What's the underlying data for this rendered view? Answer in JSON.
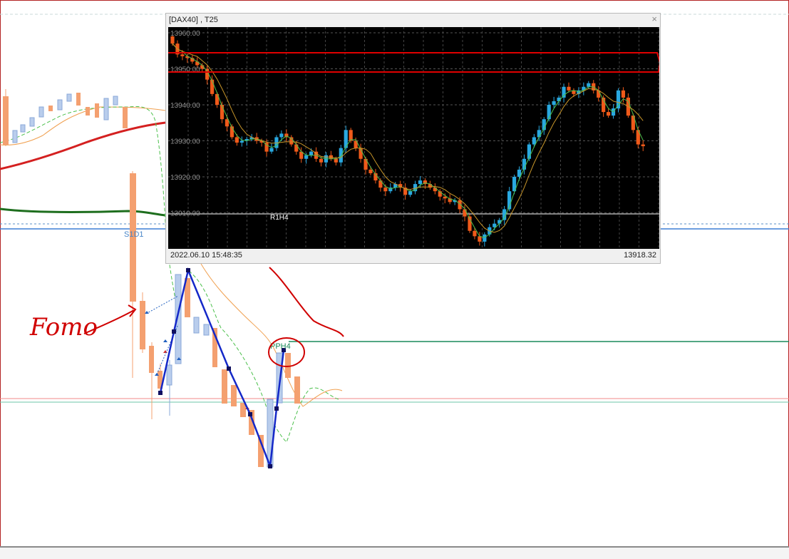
{
  "window": {
    "title": "[DAX40] , T25",
    "close_glyph": "×",
    "timestamp": "2022.06.10 15:48:35",
    "last_price": "13918.32"
  },
  "popup_chart": {
    "y_axis_labels": [
      "13960.00",
      "13950.00",
      "13940.00",
      "13930.00",
      "13920.00",
      "13910.00"
    ],
    "level_label": "R1H4"
  },
  "background_chart": {
    "level_labels": {
      "s1": "S1D1",
      "pp": "PPH4"
    },
    "annotation_text": "Fomo"
  },
  "colors": {
    "bull_popup": "#29a8e0",
    "bear_popup": "#f05a1a",
    "bull_bg": "#b9cdec",
    "bear_bg": "#f4a070",
    "annotation": "#d00000",
    "zigzag": "#1428c8"
  },
  "chart_data": {
    "type": "candlestick",
    "symbol": "DAX40",
    "timeframe": "T25",
    "ylim": [
      13902,
      13962
    ],
    "close": [
      13957,
      13954,
      13953.5,
      13953,
      13952,
      13951,
      13950,
      13947,
      13943,
      13940,
      13936,
      13934,
      13931,
      13929.5,
      13930,
      13930.5,
      13931,
      13930,
      13929.5,
      13927,
      13928,
      13931,
      13932,
      13931,
      13929,
      13927,
      13925,
      13926,
      13927,
      13925,
      13924,
      13926,
      13925,
      13924,
      13928,
      13933,
      13930,
      13928,
      13925,
      13922,
      13921,
      13919,
      13917,
      13916,
      13917,
      13918,
      13917,
      13915,
      13916,
      13918,
      13919,
      13918,
      13917,
      13916,
      13914.5,
      13914,
      13913,
      13913.5,
      13911,
      13909,
      13905,
      13903.5,
      13902,
      13904,
      13906,
      13907,
      13908,
      13911,
      13916,
      13920,
      13922,
      13925,
      13929,
      13931,
      13933,
      13936,
      13940,
      13941,
      13942,
      13945,
      13944,
      13943,
      13944,
      13945,
      13946,
      13944,
      13942,
      13938,
      13937,
      13939,
      13944,
      13942,
      13937,
      13933,
      13929,
      13928.5
    ]
  }
}
